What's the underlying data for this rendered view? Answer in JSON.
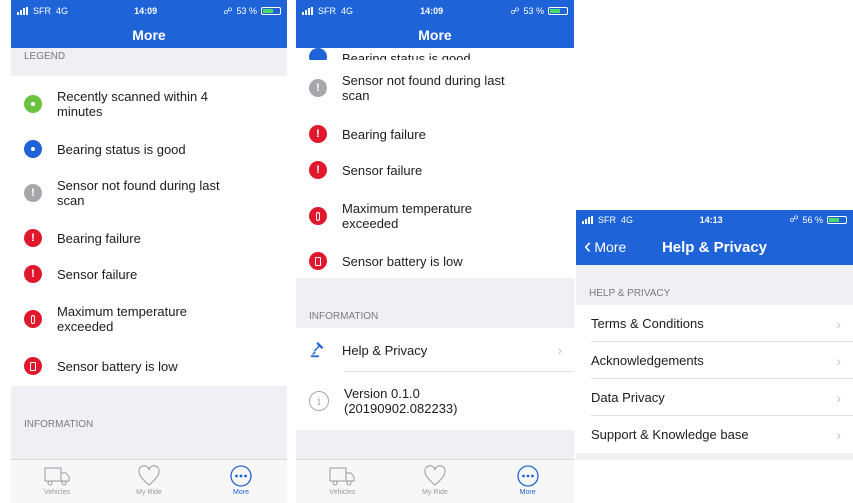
{
  "status": {
    "carrier": "SFR",
    "network": "4G",
    "time_a": "14:09",
    "battery_a": "53 %",
    "time_b": "14:13",
    "battery_b": "56 %",
    "battery_a_level": 0.53,
    "battery_b_level": 0.56
  },
  "nav": {
    "more_title": "More",
    "help_title": "Help & Privacy",
    "back_label": "More"
  },
  "legend": {
    "header": "LEGEND",
    "items": [
      {
        "label": "Recently scanned within 4 minutes",
        "icon": "scan-icon",
        "color": "#6cc140"
      },
      {
        "label": "Bearing status is good",
        "icon": "bearing-good-icon",
        "color": "#1f63d8"
      },
      {
        "label": "Sensor not found during last scan",
        "icon": "exclamation-icon",
        "color": "#a7a7ab"
      },
      {
        "label": "Bearing failure",
        "icon": "exclamation-icon",
        "color": "#e0182d"
      },
      {
        "label": "Sensor failure",
        "icon": "exclamation-icon",
        "color": "#e0182d"
      },
      {
        "label": "Maximum temperature exceeded",
        "icon": "thermometer-icon",
        "color": "#e0182d"
      },
      {
        "label": "Sensor battery is low",
        "icon": "battery-low-icon",
        "color": "#e0182d"
      }
    ],
    "partial_item": "Bearing status is good"
  },
  "information": {
    "header": "INFORMATION",
    "help_privacy": "Help & Privacy",
    "version_line1": "Version 0.1.0",
    "version_line2": "(20190902.082233)"
  },
  "tabs": {
    "vehicles": "Vehicles",
    "my_ride": "My Ride",
    "more": "More"
  },
  "help_privacy": {
    "header": "HELP & PRIVACY",
    "items": [
      "Terms & Conditions",
      "Acknowledgements",
      "Data Privacy",
      "Support & Knowledge base"
    ]
  }
}
